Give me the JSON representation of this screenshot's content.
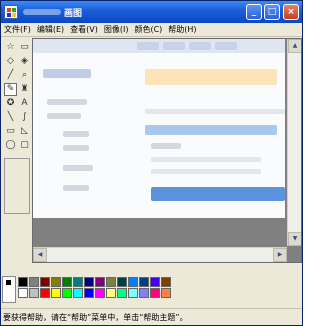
{
  "window": {
    "title": "画图",
    "buttons": {
      "minimize": "_",
      "maximize": "□",
      "close": "×"
    }
  },
  "menu": [
    {
      "id": "file",
      "label": "文件(F)"
    },
    {
      "id": "edit",
      "label": "编辑(E)"
    },
    {
      "id": "view",
      "label": "查看(V)"
    },
    {
      "id": "image",
      "label": "图像(I)"
    },
    {
      "id": "colors",
      "label": "颜色(C)"
    },
    {
      "id": "help",
      "label": "帮助(H)"
    }
  ],
  "tools": [
    {
      "name": "free-select-icon",
      "glyph": "☆"
    },
    {
      "name": "select-icon",
      "glyph": "▭"
    },
    {
      "name": "eraser-icon",
      "glyph": "◇"
    },
    {
      "name": "fill-icon",
      "glyph": "◈"
    },
    {
      "name": "pick-color-icon",
      "glyph": "╱"
    },
    {
      "name": "magnifier-icon",
      "glyph": "⌕"
    },
    {
      "name": "pencil-icon",
      "glyph": "✎"
    },
    {
      "name": "brush-icon",
      "glyph": "♜"
    },
    {
      "name": "airbrush-icon",
      "glyph": "✪"
    },
    {
      "name": "text-icon",
      "glyph": "A"
    },
    {
      "name": "line-icon",
      "glyph": "╲"
    },
    {
      "name": "curve-icon",
      "glyph": "∫"
    },
    {
      "name": "rectangle-icon",
      "glyph": "▭"
    },
    {
      "name": "polygon-icon",
      "glyph": "◺"
    },
    {
      "name": "ellipse-icon",
      "glyph": "◯"
    },
    {
      "name": "rounded-rectangle-icon",
      "glyph": "▢"
    }
  ],
  "selected_tool_index": 6,
  "scrollbar": {
    "up": "▲",
    "down": "▼",
    "left": "◀",
    "right": "▶"
  },
  "palette": {
    "foreground": "#000000",
    "background": "#ffffff",
    "colors": [
      "#000000",
      "#808080",
      "#800000",
      "#808000",
      "#008000",
      "#008080",
      "#000080",
      "#800080",
      "#808040",
      "#004040",
      "#0080ff",
      "#004080",
      "#4000ff",
      "#804000",
      "#ffffff",
      "#c0c0c0",
      "#ff0000",
      "#ffff00",
      "#00ff00",
      "#00ffff",
      "#0000ff",
      "#ff00ff",
      "#ffff80",
      "#00ff80",
      "#80ffff",
      "#8080ff",
      "#ff0080",
      "#ff8040"
    ]
  },
  "status": {
    "text": "要获得帮助，请在“帮助”菜单中，单击“帮助主题”。"
  }
}
